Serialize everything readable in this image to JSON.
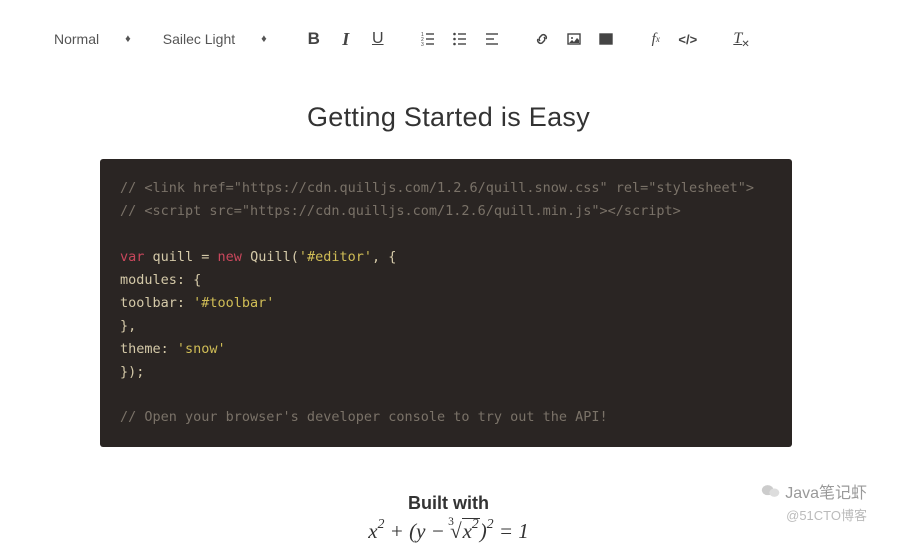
{
  "toolbar": {
    "header_value": "Normal",
    "font_value": "Sailec Light"
  },
  "heading": "Getting Started is Easy",
  "code": {
    "line1": "// <link href=\"https://cdn.quilljs.com/1.2.6/quill.snow.css\" rel=\"stylesheet\">",
    "line2": "// <script src=\"https://cdn.quilljs.com/1.2.6/quill.min.js\"></script>",
    "kw_var": "var",
    "ident_quill": " quill = ",
    "kw_new": "new",
    "ctor": " Quill(",
    "str_editor": "'#editor'",
    "after_ctor": ", {",
    "modules": "  modules: {",
    "toolbar_key": "    toolbar: ",
    "str_toolbar": "'#toolbar'",
    "close_modules": "  },",
    "theme_key": "  theme: ",
    "str_snow": "'snow'",
    "close": "});",
    "comment_end": "// Open your browser's developer console to try out the API!"
  },
  "built": {
    "label": "Built with",
    "formula_source": "x^2 + (y - \\sqrt[3]{x^2})^2 = 1"
  },
  "watermark": {
    "brand": "Java笔记虾",
    "sub": "@51CTO博客"
  }
}
